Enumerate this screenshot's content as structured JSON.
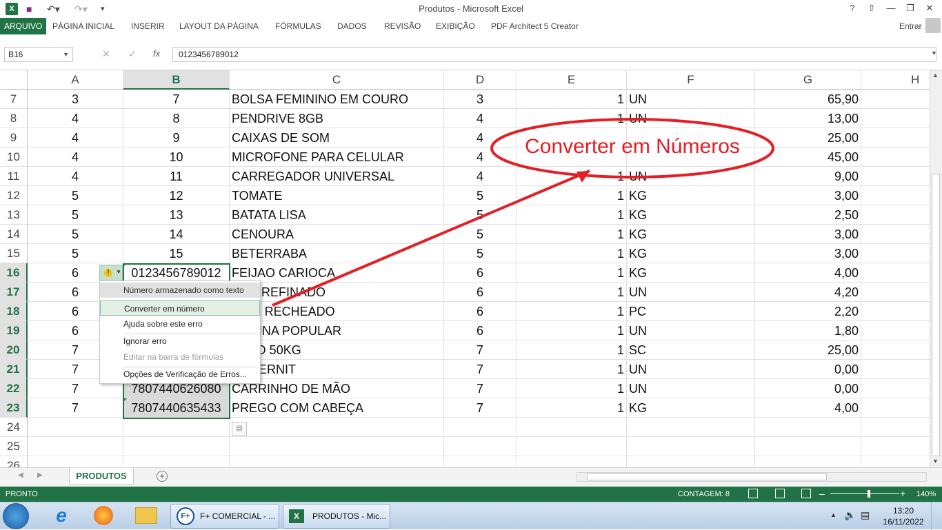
{
  "window": {
    "title": "Produtos - Microsoft Excel",
    "user": "Entrar"
  },
  "ribbon": {
    "tabs": [
      {
        "label": "ARQUIVO",
        "active": true
      },
      {
        "label": "PÁGINA INICIAL"
      },
      {
        "label": "INSERIR"
      },
      {
        "label": "LAYOUT DA PÁGINA"
      },
      {
        "label": "FÓRMULAS"
      },
      {
        "label": "DADOS"
      },
      {
        "label": "REVISÃO"
      },
      {
        "label": "EXIBIÇÃO"
      },
      {
        "label": "PDF Architect 5 Creator"
      }
    ]
  },
  "formula_bar": {
    "name_box": "B16",
    "fx": "fx",
    "value": "0123456789012"
  },
  "grid": {
    "columns": [
      "A",
      "B",
      "C",
      "D",
      "E",
      "F",
      "G",
      "H"
    ],
    "selected_column": "B",
    "rows": [
      {
        "n": "7",
        "a": "3",
        "b": "7",
        "c": "BOLSA FEMININO EM COURO",
        "d": "3",
        "e": "1",
        "f": "UN",
        "g": "65,90"
      },
      {
        "n": "8",
        "a": "4",
        "b": "8",
        "c": "PENDRIVE 8GB",
        "d": "4",
        "e": "1",
        "f": "UN",
        "g": "13,00"
      },
      {
        "n": "9",
        "a": "4",
        "b": "9",
        "c": "CAIXAS DE SOM",
        "d": "4",
        "e": "",
        "f": "",
        "g": "25,00"
      },
      {
        "n": "10",
        "a": "4",
        "b": "10",
        "c": "MICROFONE PARA CELULAR",
        "d": "4",
        "e": "",
        "f": "",
        "g": "45,00"
      },
      {
        "n": "11",
        "a": "4",
        "b": "11",
        "c": "CARREGADOR UNIVERSAL",
        "d": "4",
        "e": "1",
        "f": "UN",
        "g": "9,00"
      },
      {
        "n": "12",
        "a": "5",
        "b": "12",
        "c": "TOMATE",
        "d": "5",
        "e": "1",
        "f": "KG",
        "g": "3,00"
      },
      {
        "n": "13",
        "a": "5",
        "b": "13",
        "c": "BATATA LISA",
        "d": "5",
        "e": "1",
        "f": "KG",
        "g": "2,50"
      },
      {
        "n": "14",
        "a": "5",
        "b": "14",
        "c": "CENOURA",
        "d": "5",
        "e": "1",
        "f": "KG",
        "g": "3,00"
      },
      {
        "n": "15",
        "a": "5",
        "b": "15",
        "c": "BETERRABA",
        "d": "5",
        "e": "1",
        "f": "KG",
        "g": "3,00"
      },
      {
        "n": "16",
        "a": "6",
        "b": "0123456789012",
        "c": "FEIJAO CARIOCA",
        "d": "6",
        "e": "1",
        "f": "KG",
        "g": "4,00"
      },
      {
        "n": "17",
        "a": "6",
        "b": "",
        "c": "CAR REFINADO",
        "d": "6",
        "e": "1",
        "f": "UN",
        "g": "4,20"
      },
      {
        "n": "18",
        "a": "6",
        "b": "",
        "c": "DITO RECHEADO",
        "d": "6",
        "e": "1",
        "f": "PC",
        "g": "2,20"
      },
      {
        "n": "19",
        "a": "6",
        "b": "",
        "c": "GARINA POPULAR",
        "d": "6",
        "e": "1",
        "f": "UN",
        "g": "1,80"
      },
      {
        "n": "20",
        "a": "7",
        "b": "",
        "c": "ENTO 50KG",
        "d": "7",
        "e": "1",
        "f": "SC",
        "g": "25,00"
      },
      {
        "n": "21",
        "a": "7",
        "b": "",
        "c": "A ETERNIT",
        "d": "7",
        "e": "1",
        "f": "UN",
        "g": "0,00"
      },
      {
        "n": "22",
        "a": "7",
        "b": "7807440626080",
        "c": "CARRINHO DE MÃO",
        "d": "7",
        "e": "1",
        "f": "UN",
        "g": "0,00"
      },
      {
        "n": "23",
        "a": "7",
        "b": "7807440635433",
        "c": "PREGO COM CABEÇA",
        "d": "7",
        "e": "1",
        "f": "KG",
        "g": "4,00"
      },
      {
        "n": "24",
        "a": "",
        "b": "",
        "c": "",
        "d": "",
        "e": "",
        "f": "",
        "g": ""
      },
      {
        "n": "25",
        "a": "",
        "b": "",
        "c": "",
        "d": "",
        "e": "",
        "f": "",
        "g": ""
      },
      {
        "n": "26",
        "a": "",
        "b": "",
        "c": "",
        "d": "",
        "e": "",
        "f": "",
        "g": ""
      }
    ],
    "selected_rows": [
      "16",
      "17",
      "18",
      "19",
      "20",
      "21",
      "22",
      "23"
    ]
  },
  "context_menu": {
    "header": "Número armazenado como texto",
    "items": [
      {
        "label": "Converter em número",
        "hot": true
      },
      {
        "label": "Ajuda sobre este erro"
      },
      {
        "label": "Ignorar erro"
      },
      {
        "label": "Editar na barra de fórmulas",
        "disabled": true
      },
      {
        "label": "Opções de Verificação de Erros..."
      }
    ]
  },
  "annotation": {
    "text": "Converter em Números",
    "color": "#e31e24"
  },
  "sheets": {
    "tabs": [
      "PRODUTOS"
    ]
  },
  "status": {
    "left": "PRONTO",
    "count": "CONTAGEM: 8",
    "zoom": "140%"
  },
  "taskbar": {
    "buttons": [
      "F+ COMERCIAL - ...",
      "PRODUTOS - Mic..."
    ],
    "time": "13:20",
    "date": "16/11/2022"
  },
  "colors": {
    "accent": "#217346"
  }
}
